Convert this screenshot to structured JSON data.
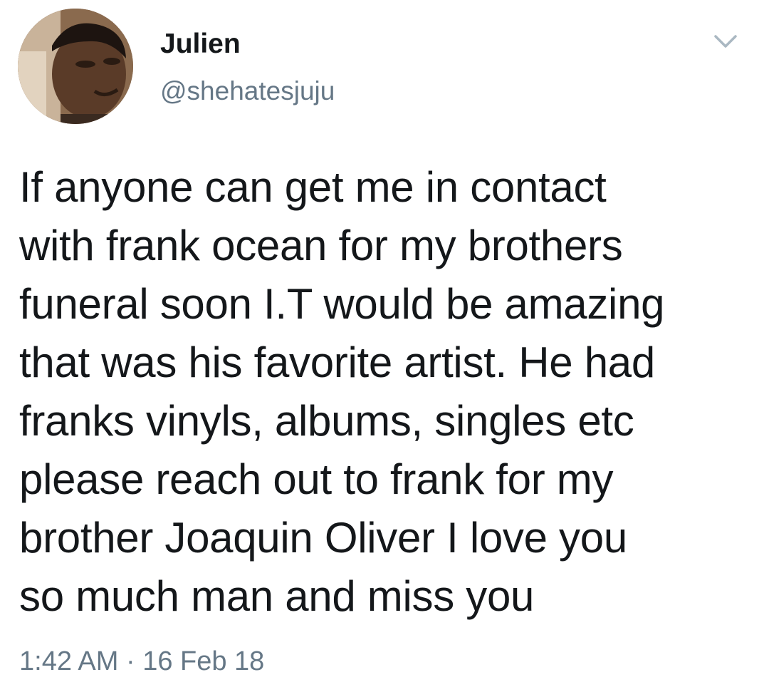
{
  "tweet": {
    "author": {
      "display_name": "Julien",
      "handle": "@shehatesjuju",
      "avatar_icon": "profile-photo-avatar"
    },
    "menu_icon": "chevron-down-icon",
    "text": "If anyone can get me in contact\nwith frank ocean for my brothers\nfuneral soon I.T would be amazing\nthat was his favorite artist. He had\nfranks vinyls, albums, singles etc\nplease reach out to frank for my\nbrother Joaquin Oliver I love you\nso much man and miss you",
    "timestamp": "1:42 AM · 16 Feb 18"
  },
  "colors": {
    "text_primary": "#14171a",
    "text_secondary": "#657786",
    "caret": "#aab8c2",
    "background": "#ffffff"
  }
}
